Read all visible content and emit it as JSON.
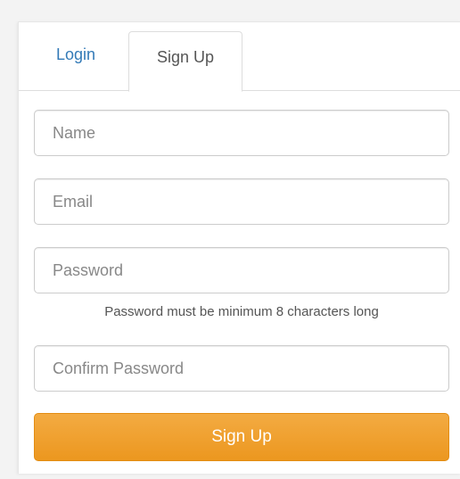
{
  "tabs": {
    "login_label": "Login",
    "signup_label": "Sign Up",
    "active": "Sign Up"
  },
  "form": {
    "name_placeholder": "Name",
    "email_placeholder": "Email",
    "password_placeholder": "Password",
    "password_hint": "Password must be minimum 8 characters long",
    "confirm_placeholder": "Confirm Password",
    "submit_label": "Sign Up"
  },
  "colors": {
    "link": "#337ab7",
    "button": "#f0a030"
  }
}
